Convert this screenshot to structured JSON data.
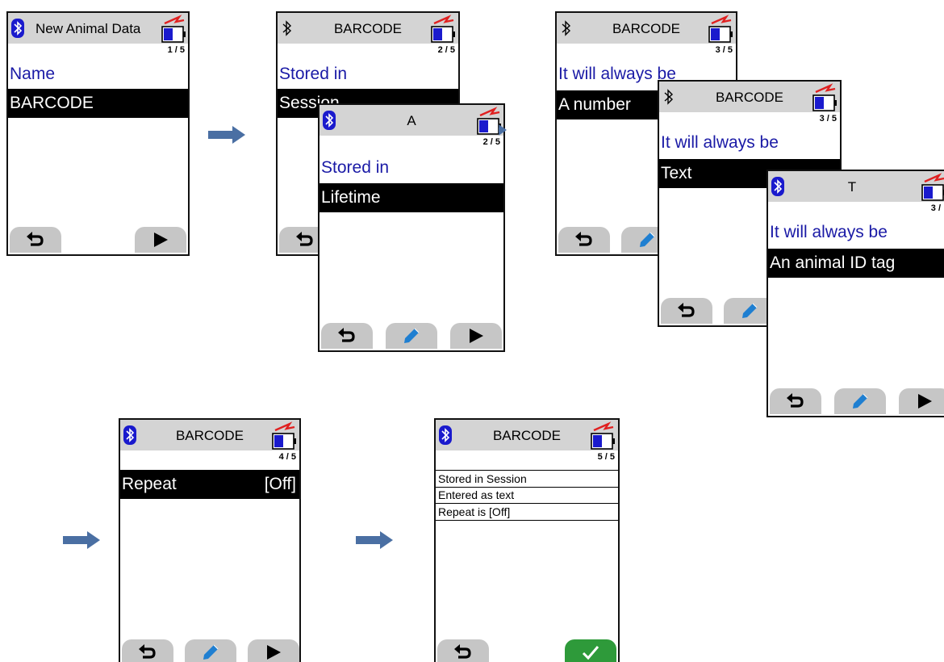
{
  "icons": {
    "bluetooth": "bluetooth-icon",
    "battery": "battery-charging-icon",
    "back": "back-arrow-icon",
    "edit": "pencil-icon",
    "next": "play-icon",
    "confirm": "checkmark-icon",
    "flow": "right-arrow-icon"
  },
  "colors": {
    "header": "#d4d4d4",
    "label_blue": "#1a1aa6",
    "battery_blue": "#1a1acd",
    "battery_red": "#e02020",
    "edit_blue": "#1f7fd1",
    "flow_arrow": "#4a6fa3",
    "confirm_green": "#2e9a3a"
  },
  "screen1": {
    "title": "New Animal Data",
    "step": "1 / 5",
    "label": "Name",
    "selected": "BARCODE"
  },
  "screen2": {
    "title": "BARCODE",
    "step": "2 / 5",
    "label": "Stored in",
    "selected": "Session"
  },
  "screen2b": {
    "title": "A",
    "step": "2 / 5",
    "label": "Stored in",
    "selected": "Lifetime"
  },
  "screen3": {
    "title": "BARCODE",
    "step": "3 / 5",
    "label": "It will always be",
    "selected": "A number"
  },
  "screen3b": {
    "title": "BARCODE",
    "step": "3 / 5",
    "label": "It will always be",
    "selected": "Text"
  },
  "screen3c": {
    "title": "T",
    "step": "3 /",
    "label": "It will always be",
    "selected": "An animal ID tag"
  },
  "screen4": {
    "title": "BARCODE",
    "step": "4 / 5",
    "selected": "Repeat",
    "selected_value": "[Off]"
  },
  "screen5": {
    "title": "BARCODE",
    "step": "5 / 5",
    "summary": [
      "Stored in Session",
      "Entered as text",
      "Repeat is [Off]"
    ]
  }
}
